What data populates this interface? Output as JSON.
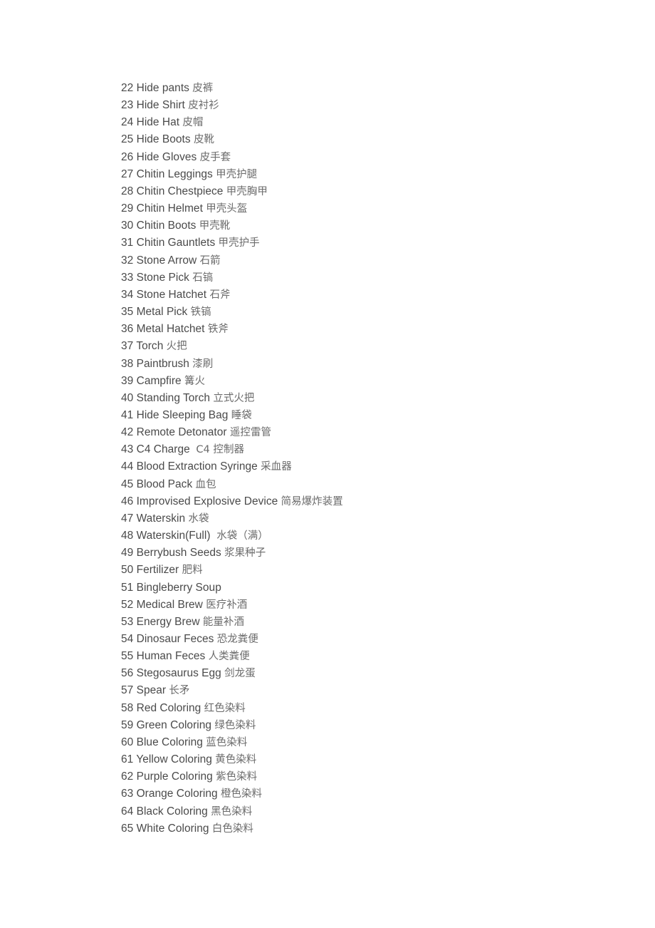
{
  "document": {
    "type": "item-reference-list",
    "page_background": "#ffffff",
    "text_color": "#4a4a4a",
    "translation_color": "#6b6b6b",
    "lines": [
      {
        "index": "22",
        "en": "Hide pants",
        "zh": "皮裤"
      },
      {
        "index": "23",
        "en": "Hide Shirt",
        "zh": "皮衬衫"
      },
      {
        "index": "24",
        "en": "Hide Hat",
        "zh": "皮帽"
      },
      {
        "index": "25",
        "en": "Hide Boots",
        "zh": "皮靴"
      },
      {
        "index": "26",
        "en": "Hide Gloves",
        "zh": "皮手套"
      },
      {
        "index": "27",
        "en": "Chitin Leggings",
        "zh": "甲壳护腿"
      },
      {
        "index": "28",
        "en": "Chitin Chestpiece",
        "zh": "甲壳胸甲"
      },
      {
        "index": "29",
        "en": "Chitin Helmet",
        "zh": "甲壳头盔"
      },
      {
        "index": "30",
        "en": "Chitin Boots",
        "zh": "甲壳靴"
      },
      {
        "index": "31",
        "en": "Chitin Gauntlets",
        "zh": "甲壳护手"
      },
      {
        "index": "32",
        "en": "Stone Arrow",
        "zh": "石箭"
      },
      {
        "index": "33",
        "en": "Stone Pick",
        "zh": "石镐"
      },
      {
        "index": "34",
        "en": "Stone Hatchet",
        "zh": "石斧"
      },
      {
        "index": "35",
        "en": "Metal Pick",
        "zh": "铁镐"
      },
      {
        "index": "36",
        "en": "Metal Hatchet",
        "zh": "铁斧"
      },
      {
        "index": "37",
        "en": "Torch",
        "zh": "火把"
      },
      {
        "index": "38",
        "en": "Paintbrush",
        "zh": "漆刷"
      },
      {
        "index": "39",
        "en": "Campfire",
        "zh": "篝火"
      },
      {
        "index": "40",
        "en": "Standing Torch",
        "zh": "立式火把"
      },
      {
        "index": "41",
        "en": "Hide Sleeping Bag",
        "zh": "睡袋"
      },
      {
        "index": "42",
        "en": "Remote Detonator",
        "zh": "遥控雷管"
      },
      {
        "index": "43",
        "en": "C4 Charge ",
        "zh": "C4 控制器"
      },
      {
        "index": "44",
        "en": "Blood Extraction Syringe",
        "zh": "采血器"
      },
      {
        "index": "45",
        "en": "Blood Pack",
        "zh": "血包"
      },
      {
        "index": "46",
        "en": "Improvised Explosive Device",
        "zh": "简易爆炸装置"
      },
      {
        "index": "47",
        "en": "Waterskin",
        "zh": "水袋"
      },
      {
        "index": "48",
        "en": "Waterskin(Full) ",
        "zh": "水袋（满）"
      },
      {
        "index": "49",
        "en": "Berrybush Seeds",
        "zh": "浆果种子"
      },
      {
        "index": "50",
        "en": "Fertilizer",
        "zh": "肥料"
      },
      {
        "index": "51",
        "en": "Bingleberry Soup",
        "zh": ""
      },
      {
        "index": "52",
        "en": "Medical Brew",
        "zh": "医疗补酒"
      },
      {
        "index": "53",
        "en": "Energy Brew",
        "zh": "能量补酒"
      },
      {
        "index": "54",
        "en": "Dinosaur Feces",
        "zh": "恐龙粪便"
      },
      {
        "index": "55",
        "en": "Human Feces",
        "zh": "人类粪便"
      },
      {
        "index": "56",
        "en": "Stegosaurus Egg",
        "zh": "剑龙蛋"
      },
      {
        "index": "57",
        "en": "Spear",
        "zh": "长矛"
      },
      {
        "index": "58",
        "en": "Red Coloring",
        "zh": "红色染料"
      },
      {
        "index": "59",
        "en": "Green Coloring",
        "zh": "绿色染料"
      },
      {
        "index": "60",
        "en": "Blue Coloring",
        "zh": "蓝色染料"
      },
      {
        "index": "61",
        "en": "Yellow Coloring",
        "zh": "黄色染料"
      },
      {
        "index": "62",
        "en": "Purple Coloring",
        "zh": "紫色染料"
      },
      {
        "index": "63",
        "en": "Orange Coloring",
        "zh": "橙色染料"
      },
      {
        "index": "64",
        "en": "Black Coloring",
        "zh": "黑色染料"
      },
      {
        "index": "65",
        "en": "White Coloring",
        "zh": "白色染料"
      }
    ]
  }
}
